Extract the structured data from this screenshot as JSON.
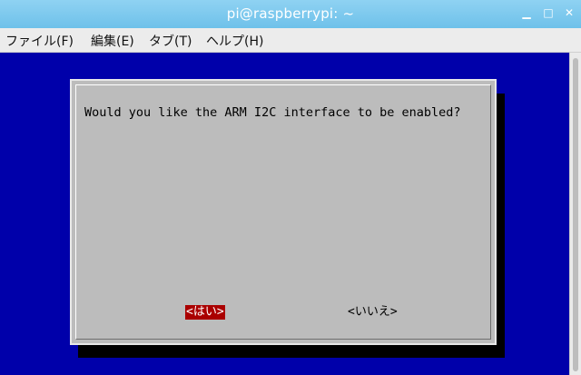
{
  "window": {
    "title": "pi@raspberrypi: ~",
    "controls": {
      "minimize": "▁",
      "maximize": "□",
      "close": "✕"
    }
  },
  "menubar": {
    "items": [
      {
        "label": "ファイル(F)"
      },
      {
        "label": "編集(E)"
      },
      {
        "label": "タブ(T)"
      },
      {
        "label": "ヘルプ(H)"
      }
    ]
  },
  "dialog": {
    "question": "Would you like the ARM I2C interface to be enabled?",
    "yes_label": "<はい>",
    "no_label": "<いいえ>",
    "selected": "yes"
  },
  "colors": {
    "terminal_bg": "#0000aa",
    "dialog_bg": "#bcbcbc",
    "selected_button_bg": "#aa0000",
    "titlebar": "#7ec9ee"
  }
}
